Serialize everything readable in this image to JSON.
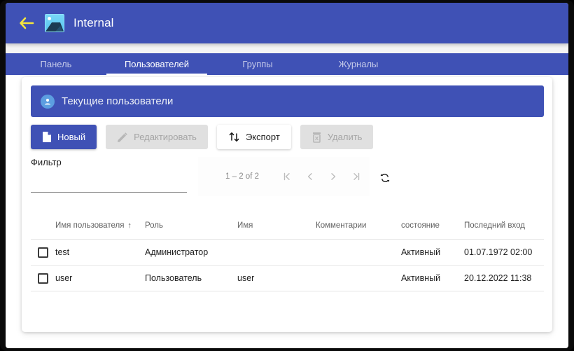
{
  "appbar": {
    "back_icon": "back-arrow-icon",
    "app_icon": "image-placeholder-icon",
    "title": "Internal"
  },
  "tabs": [
    {
      "label": "Панель",
      "active": false
    },
    {
      "label": "Пользователей",
      "active": true
    },
    {
      "label": "Группы",
      "active": false
    },
    {
      "label": "Журналы",
      "active": false
    }
  ],
  "card": {
    "header_icon": "user-circle-icon",
    "header_title": "Текущие пользователи"
  },
  "toolbar": {
    "new_label": "Новый",
    "edit_label": "Редактировать",
    "export_label": "Экспорт",
    "delete_label": "Удалить",
    "new_icon": "document-icon",
    "edit_icon": "pencil-icon",
    "export_icon": "sort-arrows-icon",
    "delete_icon": "trash-icon"
  },
  "filter": {
    "label": "Фильтр",
    "value": "",
    "placeholder": ""
  },
  "paginator": {
    "range": "1 – 2 of 2",
    "first_icon": "first-page-icon",
    "prev_icon": "previous-page-icon",
    "next_icon": "next-page-icon",
    "last_icon": "last-page-icon",
    "refresh_icon": "refresh-icon"
  },
  "table": {
    "columns": [
      {
        "key": "username",
        "label": "Имя пользователя",
        "sorted": true,
        "sort_dir": "↑"
      },
      {
        "key": "role",
        "label": "Роль",
        "sorted": false
      },
      {
        "key": "name",
        "label": "Имя",
        "sorted": false
      },
      {
        "key": "comments",
        "label": "Комментарии",
        "sorted": false
      },
      {
        "key": "state",
        "label": "состояние",
        "sorted": false
      },
      {
        "key": "last_login",
        "label": "Последний вход",
        "sorted": false
      }
    ],
    "rows": [
      {
        "selected": false,
        "username": "test",
        "role": "Администратор",
        "name": "",
        "comments": "",
        "state": "Активный",
        "last_login": "01.07.1972 02:00"
      },
      {
        "selected": false,
        "username": "user",
        "role": "Пользователь",
        "name": "user",
        "comments": "",
        "state": "Активный",
        "last_login": "20.12.2022 11:38"
      }
    ]
  },
  "colors": {
    "primary": "#3f51b5",
    "accent_yellow": "#f5e63d",
    "tab_inactive": "#c5cae9",
    "disabled_bg": "#e0e0e0",
    "disabled_text": "#a5a5a5",
    "page_bg": "#ffffff",
    "frame": "#000000"
  }
}
